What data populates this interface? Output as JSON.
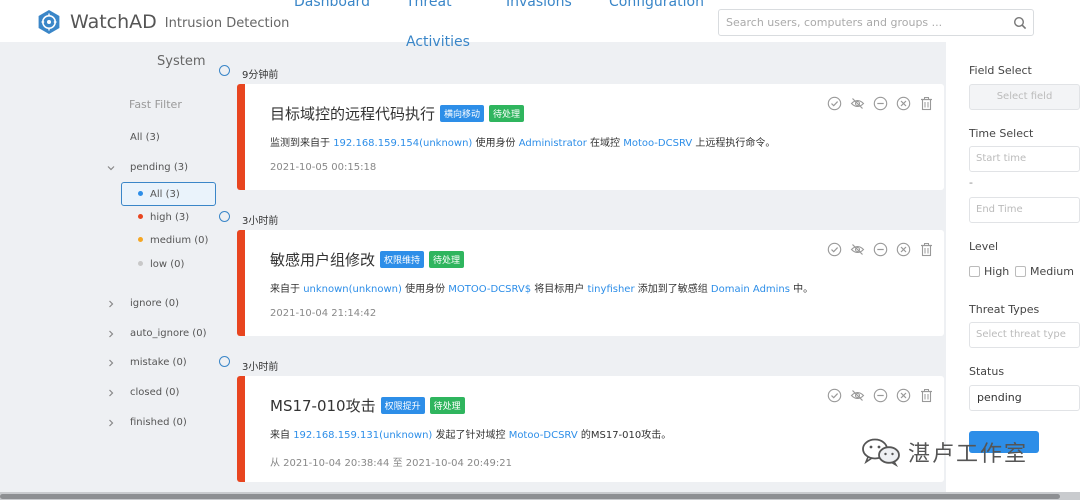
{
  "header": {
    "brand": "WatchAD",
    "brand_sub": "Intrusion Detection",
    "nav": [
      "Dashboard",
      "Threat",
      "Invasions",
      "Configuration",
      "Activities"
    ],
    "search_placeholder": "Search users, computers and groups ..."
  },
  "sidebar": {
    "system": "System",
    "fast_filter": "Fast Filter",
    "all": "All (3)",
    "pending": "pending (3)",
    "pending_children": [
      {
        "label": "All (3)",
        "color": "#2d8ee8"
      },
      {
        "label": "high (3)",
        "color": "#e8451f"
      },
      {
        "label": "medium (0)",
        "color": "#f5a623"
      },
      {
        "label": "low (0)",
        "color": "#c8c8c8"
      }
    ],
    "groups": [
      "ignore (0)",
      "auto_ignore (0)",
      "mistake (0)",
      "closed (0)",
      "finished (0)"
    ]
  },
  "timeline": [
    "9分钟前",
    "3小时前",
    "3小时前"
  ],
  "cards": [
    {
      "title": "目标域控的远程代码执行",
      "tag1": "横向移动",
      "tag2": "待处理",
      "desc": {
        "p1": "监测到来自于 ",
        "ip": "192.168.159.154",
        "p2": "(unknown)",
        "p3": " 使用身份 ",
        "user": "Administrator",
        "p4": " 在域控 ",
        "dc": "Motoo-DCSRV",
        "p5": " 上远程执行命令。"
      },
      "date": "2021-10-05 00:15:18"
    },
    {
      "title": "敏感用户组修改",
      "tag1": "权限维持",
      "tag2": "待处理",
      "desc": {
        "p1": "来自于 ",
        "ip": "unknown",
        "p2": "(unknown)",
        "p3": " 使用身份 ",
        "user": "MOTOO-DCSRV$",
        "p4": " 将目标用户 ",
        "target": "tinyfisher",
        "p5": " 添加到了敏感组 ",
        "group": "Domain Admins",
        "p6": " 中。"
      },
      "date": "2021-10-04 21:14:42"
    },
    {
      "title": "MS17-010攻击",
      "tag1": "权限提升",
      "tag2": "待处理",
      "desc": {
        "p1": "来自 ",
        "ip": "192.168.159.131",
        "p2": "(unknown)",
        "p3": " 发起了针对域控 ",
        "dc": "Motoo-DCSRV",
        "p4": " 的MS17-010攻击。"
      },
      "date": "从 2021-10-04 20:38:44 至 2021-10-04 20:49:21"
    }
  ],
  "right_panel": {
    "field_select": "Field Select",
    "field_placeholder": "Select field",
    "time_select": "Time Select",
    "start_placeholder": "Start time",
    "dash": "-",
    "end_placeholder": "End Time",
    "level": "Level",
    "level_high": "High",
    "level_medium": "Medium",
    "threat_types": "Threat Types",
    "threat_placeholder": "Select threat type",
    "status": "Status",
    "status_value": "pending"
  },
  "watermark": "湛卢工作室",
  "colors": {
    "accent": "#3a86c8",
    "severity_high": "#e8451f",
    "tag_blue": "#2d8ee8",
    "tag_green": "#2fb55e"
  }
}
